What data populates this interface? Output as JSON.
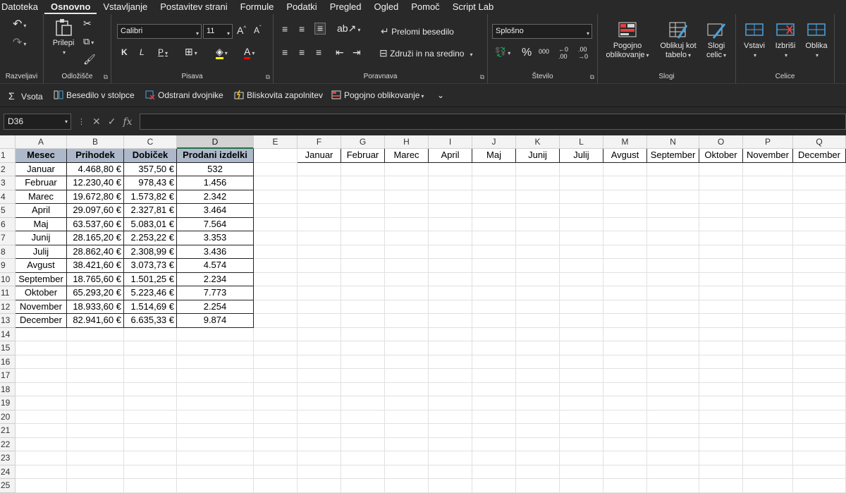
{
  "menu": [
    "Datoteka",
    "Osnovno",
    "Vstavljanje",
    "Postavitev strani",
    "Formule",
    "Podatki",
    "Pregled",
    "Ogled",
    "Pomoč",
    "Script Lab"
  ],
  "menu_active": 1,
  "ribbon": {
    "groups": {
      "undo": "Razveljavi",
      "clipboard": "Odložišče",
      "font": "Pisava",
      "alignment": "Poravnava",
      "number": "Število",
      "styles": "Slogi",
      "cells": "Celice"
    },
    "paste_label": "Prilepi",
    "font_name": "Calibri",
    "font_size": "11",
    "bold": "K",
    "italic": "L",
    "underline": "P",
    "wrap_text": "Prelomi besedilo",
    "merge_center": "Združi in na sredino",
    "number_format": "Splošno",
    "conditional_formatting": [
      "Pogojno",
      "oblikovanje"
    ],
    "format_as_table": [
      "Oblikuj kot",
      "tabelo"
    ],
    "cell_styles": [
      "Slogi",
      "celic"
    ],
    "insert": "Vstavi",
    "delete": "Izbriši",
    "format": "Oblika"
  },
  "qat": [
    "Vsota",
    "Besedilo v stolpce",
    "Odstrani dvojnike",
    "Bliskovita zapolnitev",
    "Pogojno oblikovanje"
  ],
  "name_box": "D36",
  "formula_value": "",
  "colors": {
    "header_fill": "#adb9ca",
    "ribbon_bg": "#292929",
    "select_accent": "#217346"
  },
  "columns": [
    "A",
    "B",
    "C",
    "D",
    "E",
    "F",
    "G",
    "H",
    "I",
    "J",
    "K",
    "L",
    "M",
    "N",
    "O",
    "P",
    "Q"
  ],
  "selected_column": "D",
  "rows": [
    "1",
    "2",
    "3",
    "4",
    "5",
    "6",
    "7",
    "8",
    "9",
    "10",
    "11",
    "12",
    "13",
    "14",
    "15",
    "16",
    "17",
    "18",
    "19",
    "20",
    "21",
    "22",
    "23",
    "24",
    "25"
  ],
  "table": {
    "headers": [
      "Mesec",
      "Prihodek",
      "Dobiček",
      "Prodani izdelki"
    ],
    "data": [
      [
        "Januar",
        "4.468,80 €",
        "357,50 €",
        "532"
      ],
      [
        "Februar",
        "12.230,40 €",
        "978,43 €",
        "1.456"
      ],
      [
        "Marec",
        "19.672,80 €",
        "1.573,82 €",
        "2.342"
      ],
      [
        "April",
        "29.097,60 €",
        "2.327,81 €",
        "3.464"
      ],
      [
        "Maj",
        "63.537,60 €",
        "5.083,01 €",
        "7.564"
      ],
      [
        "Junij",
        "28.165,20 €",
        "2.253,22 €",
        "3.353"
      ],
      [
        "Julij",
        "28.862,40 €",
        "2.308,99 €",
        "3.436"
      ],
      [
        "Avgust",
        "38.421,60 €",
        "3.073,73 €",
        "4.574"
      ],
      [
        "September",
        "18.765,60 €",
        "1.501,25 €",
        "2.234"
      ],
      [
        "Oktober",
        "65.293,20 €",
        "5.223,46 €",
        "7.773"
      ],
      [
        "November",
        "18.933,60 €",
        "1.514,69 €",
        "2.254"
      ],
      [
        "December",
        "82.941,60 €",
        "6.635,33 €",
        "9.874"
      ]
    ]
  },
  "month_row": [
    "Januar",
    "Februar",
    "Marec",
    "April",
    "Maj",
    "Junij",
    "Julij",
    "Avgust",
    "September",
    "Oktober",
    "November",
    "December"
  ]
}
